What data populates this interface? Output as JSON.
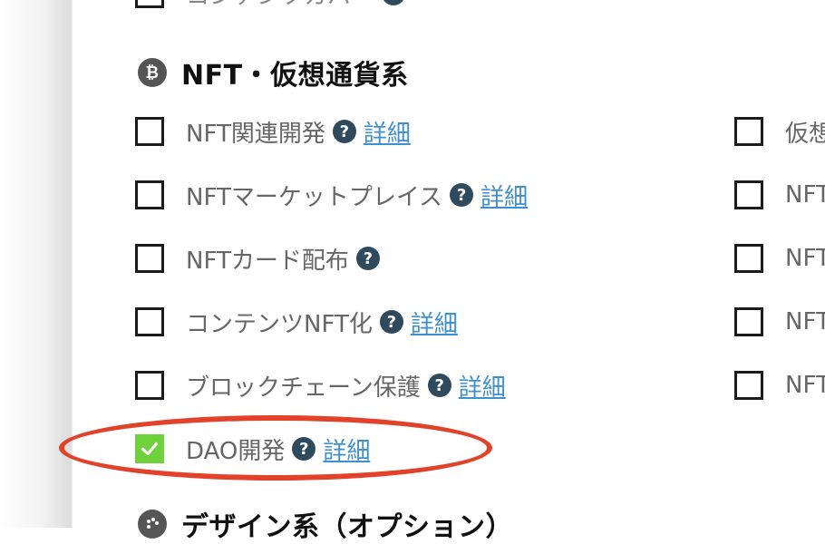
{
  "top_item": {
    "label": "コンテンツカバー"
  },
  "section": {
    "title": "NFT・仮想通貨系",
    "icon": "bitcoin-icon",
    "icon_glyph": "₿"
  },
  "left_items": [
    {
      "label": "NFT関連開発",
      "detail": "詳細",
      "checked": false
    },
    {
      "label": "NFTマーケットプレイス",
      "detail": "詳細",
      "checked": false
    },
    {
      "label": "NFTカード配布",
      "detail": "",
      "checked": false
    },
    {
      "label": "コンテンツNFT化",
      "detail": "詳細",
      "checked": false
    },
    {
      "label": "ブロックチェーン保護",
      "detail": "詳細",
      "checked": false
    },
    {
      "label": "DAO開発",
      "detail": "詳細",
      "checked": true
    }
  ],
  "right_items": [
    {
      "label": "仮想"
    },
    {
      "label": "NFT"
    },
    {
      "label": "NFT"
    },
    {
      "label": "NFT"
    },
    {
      "label": "NFT"
    }
  ],
  "next_section": {
    "title": "デザイン系（オプション）",
    "icon": "palette-icon"
  },
  "help_glyph": "?",
  "colors": {
    "check": "#6fd23c",
    "help": "#2e4a5c",
    "link": "#3e8fcf",
    "highlight": "#e2412a"
  }
}
